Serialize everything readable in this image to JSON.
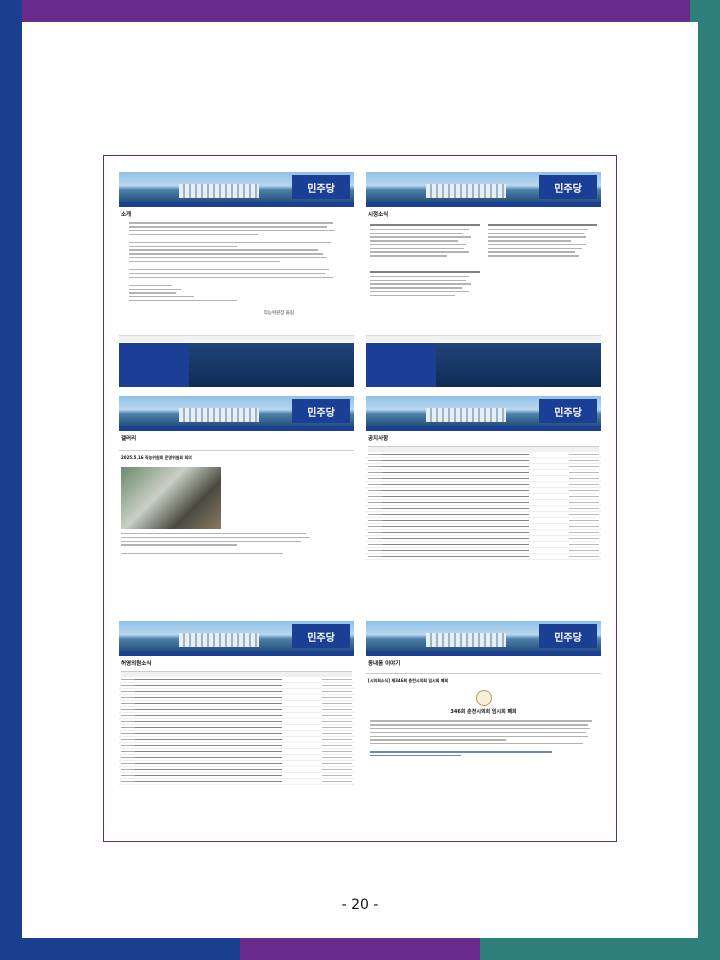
{
  "page_number": "- 20 -",
  "shots": [
    {
      "title": "소개",
      "logo": "민주당",
      "signature": "직능위원장 올림"
    },
    {
      "title": "시정소식",
      "logo": "민주당"
    },
    {
      "title": "갤러리",
      "logo": "민주당",
      "post_title": "2025.5.16 직능위원회 운영위원회 회의"
    },
    {
      "title": "공지사항",
      "logo": "민주당"
    },
    {
      "title": "허영의원소식",
      "logo": "민주당"
    },
    {
      "title": "동내음 이야기",
      "logo": "민주당",
      "post_title": "[시의회소식] 제346회 춘천시의회 임시회 폐회",
      "headline": "346회 춘천시의회 임시회 폐회"
    }
  ],
  "colors": {
    "purple": "#6a2a8c",
    "blue": "#1a3f8f",
    "teal": "#2e7f7a",
    "brand": "#1b3f94"
  }
}
